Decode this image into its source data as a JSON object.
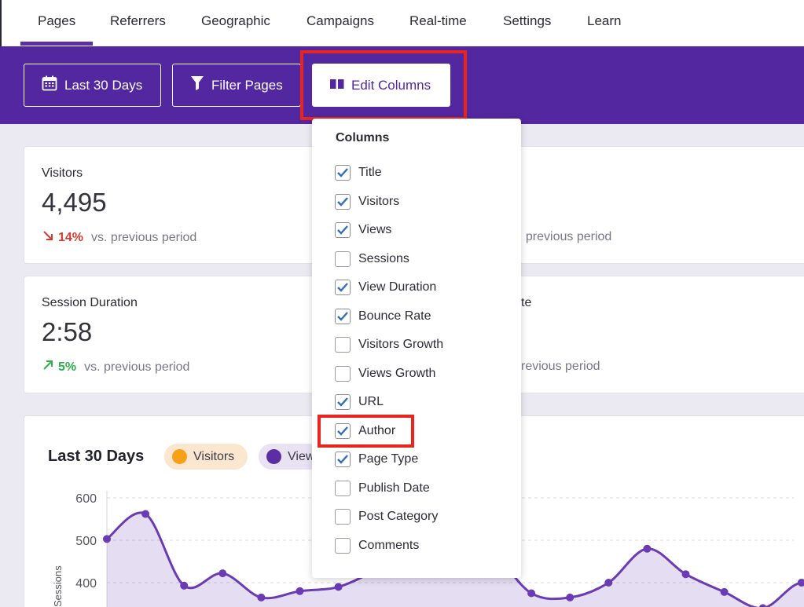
{
  "nav": {
    "tabs": [
      {
        "label": "Pages",
        "active": true
      },
      {
        "label": "Referrers"
      },
      {
        "label": "Geographic"
      },
      {
        "label": "Campaigns"
      },
      {
        "label": "Real-time"
      },
      {
        "label": "Settings"
      },
      {
        "label": "Learn"
      }
    ]
  },
  "toolbar": {
    "date_range_label": "Last 30 Days",
    "filter_label": "Filter Pages",
    "edit_columns_label": "Edit Columns"
  },
  "stats": {
    "visitors": {
      "label": "Visitors",
      "value": "4,495",
      "change": "14%",
      "direction": "down",
      "comparison": "vs. previous period"
    },
    "views_partial": {
      "value_fragment": "|",
      "comparison_fragment": ". previous period"
    },
    "session_duration": {
      "label": "Session Duration",
      "value": "2:58",
      "change": "5%",
      "direction": "up",
      "comparison": "vs. previous period"
    },
    "bounce_partial": {
      "label_fragment": "te",
      "comparison_fragment": "revious period"
    }
  },
  "chart": {
    "title": "Last 30 Days",
    "legend": [
      {
        "label": "Visitors",
        "color": "#f7a11a"
      },
      {
        "label": "View",
        "color": "#5b2ea6"
      }
    ]
  },
  "chart_data": {
    "type": "area",
    "ylabel": "Sessions",
    "yticks": [
      "600",
      "500",
      "400"
    ],
    "ylim": [
      300,
      600
    ],
    "series": [
      {
        "values": [
          503,
          562,
          393,
          422,
          365,
          380,
          390,
          430,
          470,
          500,
          470,
          375,
          365,
          400,
          480,
          420,
          378,
          340,
          400,
          360
        ]
      }
    ]
  },
  "columns_menu": {
    "title": "Columns",
    "options": [
      {
        "label": "Title",
        "checked": true
      },
      {
        "label": "Visitors",
        "checked": true
      },
      {
        "label": "Views",
        "checked": true
      },
      {
        "label": "Sessions",
        "checked": false
      },
      {
        "label": "View Duration",
        "checked": true
      },
      {
        "label": "Bounce Rate",
        "checked": true
      },
      {
        "label": "Visitors Growth",
        "checked": false
      },
      {
        "label": "Views Growth",
        "checked": false
      },
      {
        "label": "URL",
        "checked": true
      },
      {
        "label": "Author",
        "checked": true
      },
      {
        "label": "Page Type",
        "checked": true
      },
      {
        "label": "Publish Date",
        "checked": false
      },
      {
        "label": "Post Category",
        "checked": false
      },
      {
        "label": "Comments",
        "checked": false
      }
    ]
  },
  "colors": {
    "brand_purple": "#5227a0",
    "highlight_red": "#e8251f",
    "down_red": "#d63a2f",
    "up_green": "#2ab14b",
    "check_blue": "#2f6fbd"
  }
}
